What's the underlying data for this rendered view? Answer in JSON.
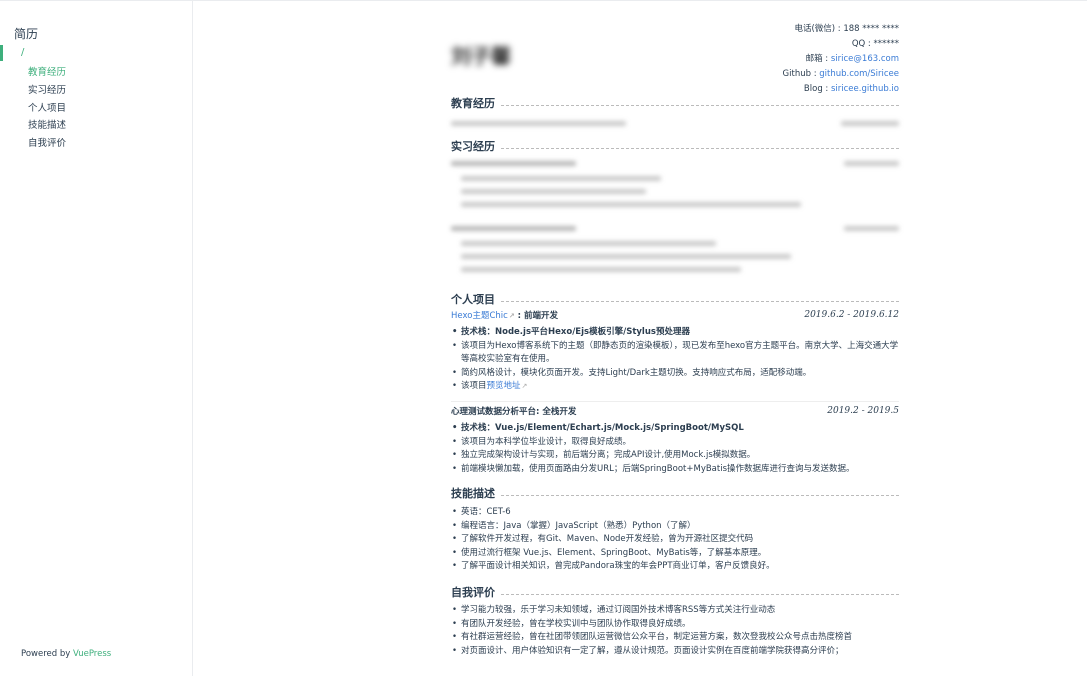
{
  "sidebar": {
    "title": "简历",
    "root": "/",
    "items": [
      "教育经历",
      "实习经历",
      "个人项目",
      "技能描述",
      "自我评价"
    ],
    "footer_prefix": "Powered by ",
    "footer_link": "VuePress"
  },
  "resume": {
    "contact": {
      "phone_label": "电话(微信) : ",
      "phone": "188 **** ****",
      "qq_label": "QQ : ",
      "qq": "******",
      "email_label": "邮箱 : ",
      "email": "sirice@163.com",
      "github_label": "Github : ",
      "github": "github.com/Siricee",
      "blog_label": "Blog : ",
      "blog": "siricee.github.io"
    },
    "sections": {
      "education": "教育经历",
      "internship": "实习经历",
      "projects": "个人项目",
      "skills": "技能描述",
      "self": "自我评价"
    },
    "project1": {
      "link": "Hexo主题Chic",
      "role": " : 前端开发",
      "date": "2019.6.2 - 2019.6.12",
      "bullets": [
        "技术栈：Node.js平台Hexo/Ejs模板引擎/Stylus预处理器",
        "该项目为Hexo博客系统下的主题（即静态页的渲染模板），现已发布至hexo官方主题平台。南京大学、上海交通大学等高校实验室有在使用。",
        "简约风格设计，模块化页面开发。支持Light/Dark主题切换。支持响应式布局，适配移动端。"
      ],
      "preview_prefix": "该项目",
      "preview_link": "预览地址"
    },
    "project2": {
      "title": "心理测试数据分析平台: 全栈开发",
      "date": "2019.2 - 2019.5",
      "bullets": [
        "技术栈：Vue.js/Element/Echart.js/Mock.js/SpringBoot/MySQL",
        "该项目为本科学位毕业设计，取得良好成绩。",
        "独立完成架构设计与实现，前后端分离；完成API设计,使用Mock.js模拟数据。",
        "前端模块懒加载，使用页面路由分发URL；后端SpringBoot+MyBatis操作数据库进行查询与发送数据。"
      ]
    },
    "skills": [
      "英语：CET-6",
      "编程语言：Java（掌握）JavaScript（熟悉）Python（了解）",
      "了解软件开发过程，有Git、Maven、Node开发经验，曾为开源社区提交代码",
      "使用过流行框架 Vue.js、Element、SpringBoot、MyBatis等，了解基本原理。",
      "了解平面设计相关知识，曾完成Pandora珠宝的年会PPT商业订单，客户反馈良好。"
    ],
    "self": [
      "学习能力较强，乐于学习未知领域，通过订阅国外技术博客RSS等方式关注行业动态",
      "有团队开发经验，曾在学校实训中与团队协作取得良好成绩。",
      "有社群运营经验，曾在社团带领团队运营微信公众平台，制定运营方案，数次登我校公众号点击热度榜首",
      "对页面设计、用户体验知识有一定了解，遵从设计规范。页面设计实例在百度前端学院获得高分评价；"
    ]
  }
}
